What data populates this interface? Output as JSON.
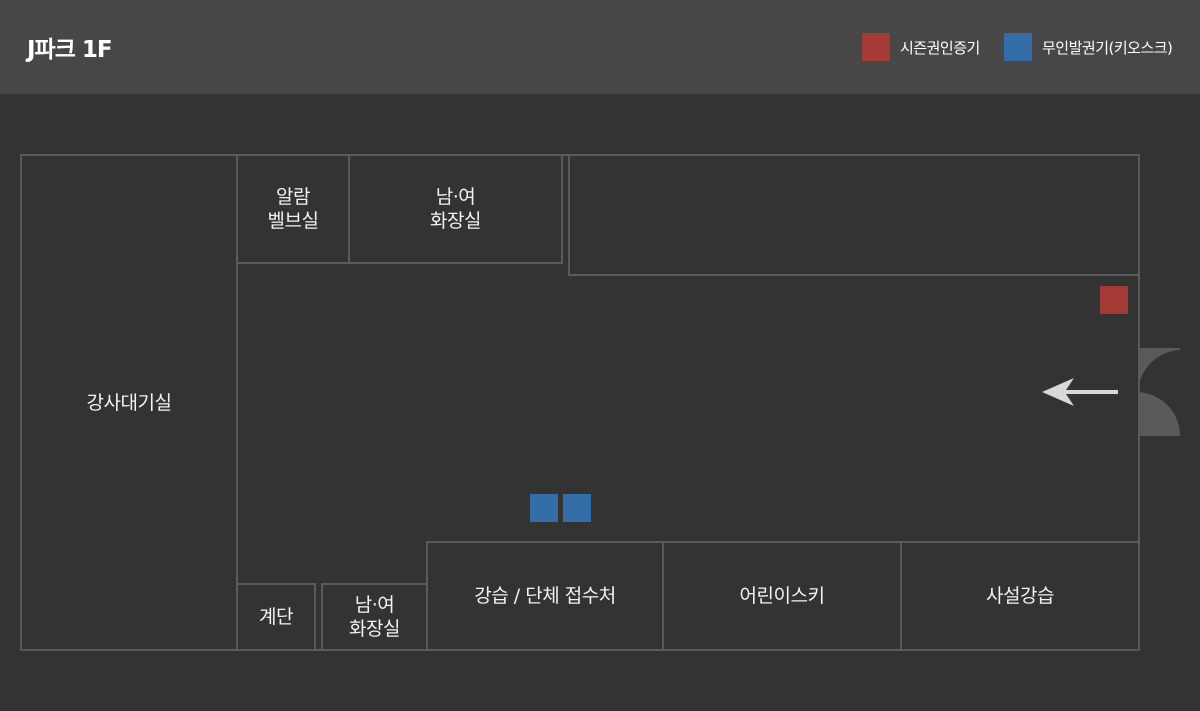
{
  "header": {
    "title": "J파크 1F"
  },
  "legend": [
    {
      "label": "시즌권인증기",
      "color": "#a33a36"
    },
    {
      "label": "무인발권기(키오스크)",
      "color": "#336ea8"
    }
  ],
  "rooms": {
    "instructor_waiting": "강사대기실",
    "alarm_valve": "알람\n벨브실",
    "restroom_top": "남·여\n화장실",
    "stairs": "계단",
    "restroom_bottom": "남·여\n화장실",
    "lesson_reception": "강습 / 단체 접수처",
    "kids_ski": "어린이스키",
    "private_lesson": "사설강습"
  },
  "colors": {
    "background": "#333333",
    "header": "#474747",
    "wall": "#5a5a5a",
    "season_pass_verifier": "#a33a36",
    "kiosk": "#336ea8"
  },
  "icons": [
    "left-arrow-icon",
    "entrance-door-icon"
  ]
}
